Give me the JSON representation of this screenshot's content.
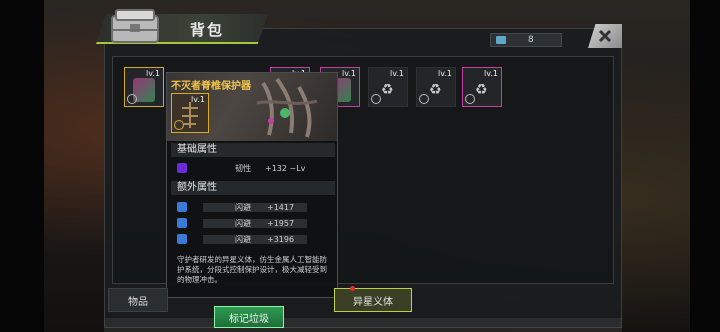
{
  "bag": {
    "title": "背包",
    "counter": "8",
    "slots": [
      {
        "level": "lv.1",
        "color": "#d7a92d",
        "type": "item"
      },
      {
        "level": "lv.1",
        "color": "#c33fa4",
        "type": "item"
      },
      {
        "level": "lv.1",
        "color": "#2e3134",
        "type": "recycle"
      },
      {
        "level": "lv.1",
        "color": "#2e3134",
        "type": "recycle"
      },
      {
        "level": "lv.1",
        "color": "#c33fa4",
        "type": "recycle"
      },
      {
        "level": "lv.1",
        "color": "#c33fa4",
        "type": "item"
      }
    ]
  },
  "tooltip": {
    "name": "不灭者脊椎保护器",
    "level": "lv.1",
    "base_header": "基础属性",
    "base_stat": {
      "name": "韧性",
      "value": "+132 ~Lv"
    },
    "extra_header": "额外属性",
    "extra_stats": [
      {
        "name": "闪避",
        "value": "+1417"
      },
      {
        "name": "闪避",
        "value": "+1957"
      },
      {
        "name": "闪避",
        "value": "+3196"
      }
    ],
    "description": "守护者研发的异星义体，仿生金属人工智能防护系统，分段式控制保护设计，极大减轻受到的物理冲击。"
  },
  "tabs": {
    "items": "物品",
    "cyber": "异星义体"
  },
  "buttons": {
    "mark_junk": "标记垃圾"
  },
  "colors": {
    "accent": "#a3c93a",
    "gold": "#f0c54a",
    "green_btn": "#2f9a52",
    "stat_icon": "#3a7bd5",
    "purple": "#6c2bd9"
  }
}
